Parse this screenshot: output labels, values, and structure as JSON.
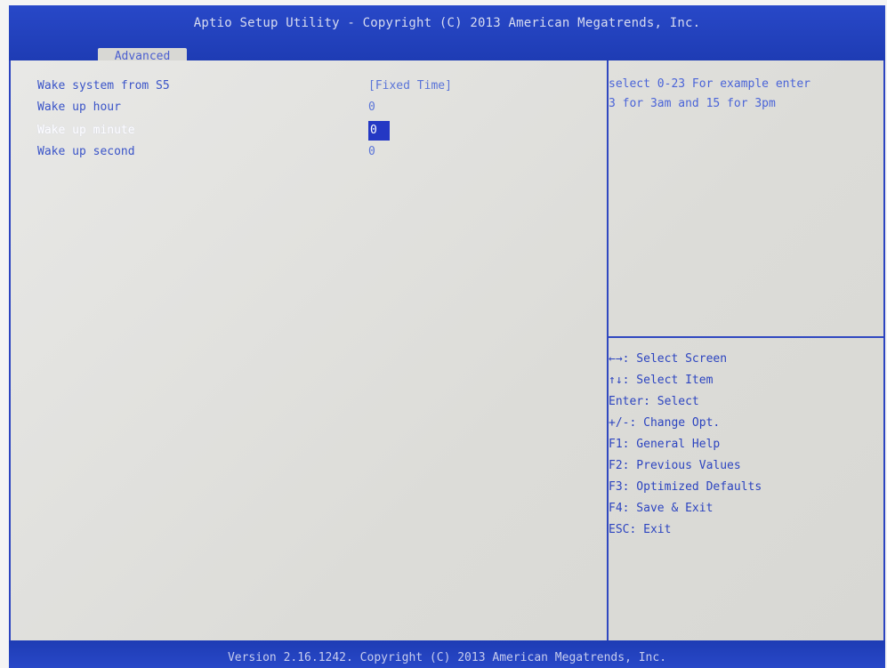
{
  "header": {
    "title": "Aptio Setup Utility - Copyright (C) 2013 American Megatrends, Inc.",
    "tabs": [
      "Advanced"
    ]
  },
  "settings": [
    {
      "label": "Wake system from S5",
      "value": "[Fixed Time]"
    },
    {
      "label": "Wake up hour",
      "value": "0"
    },
    {
      "label": "Wake up minute",
      "value": "0"
    },
    {
      "label": "Wake up second",
      "value": "0"
    }
  ],
  "selected_setting_index": 2,
  "help": {
    "text": "select 0-23 For example enter\n3 for 3am and 15 for 3pm"
  },
  "keys": [
    "←→: Select Screen",
    "↑↓: Select Item",
    "Enter: Select",
    "+/-: Change Opt.",
    "F1: General Help",
    "F2: Previous Values",
    "F3: Optimized Defaults",
    "F4: Save & Exit",
    "ESC: Exit"
  ],
  "footer": {
    "text": "Version 2.16.1242. Copyright (C) 2013 American Megatrends, Inc."
  },
  "colors": {
    "header_blue": "#2848c8",
    "panel_gray": "#dcdcd8",
    "label_blue": "#3a54c8",
    "selection_blue": "#2438c4"
  }
}
